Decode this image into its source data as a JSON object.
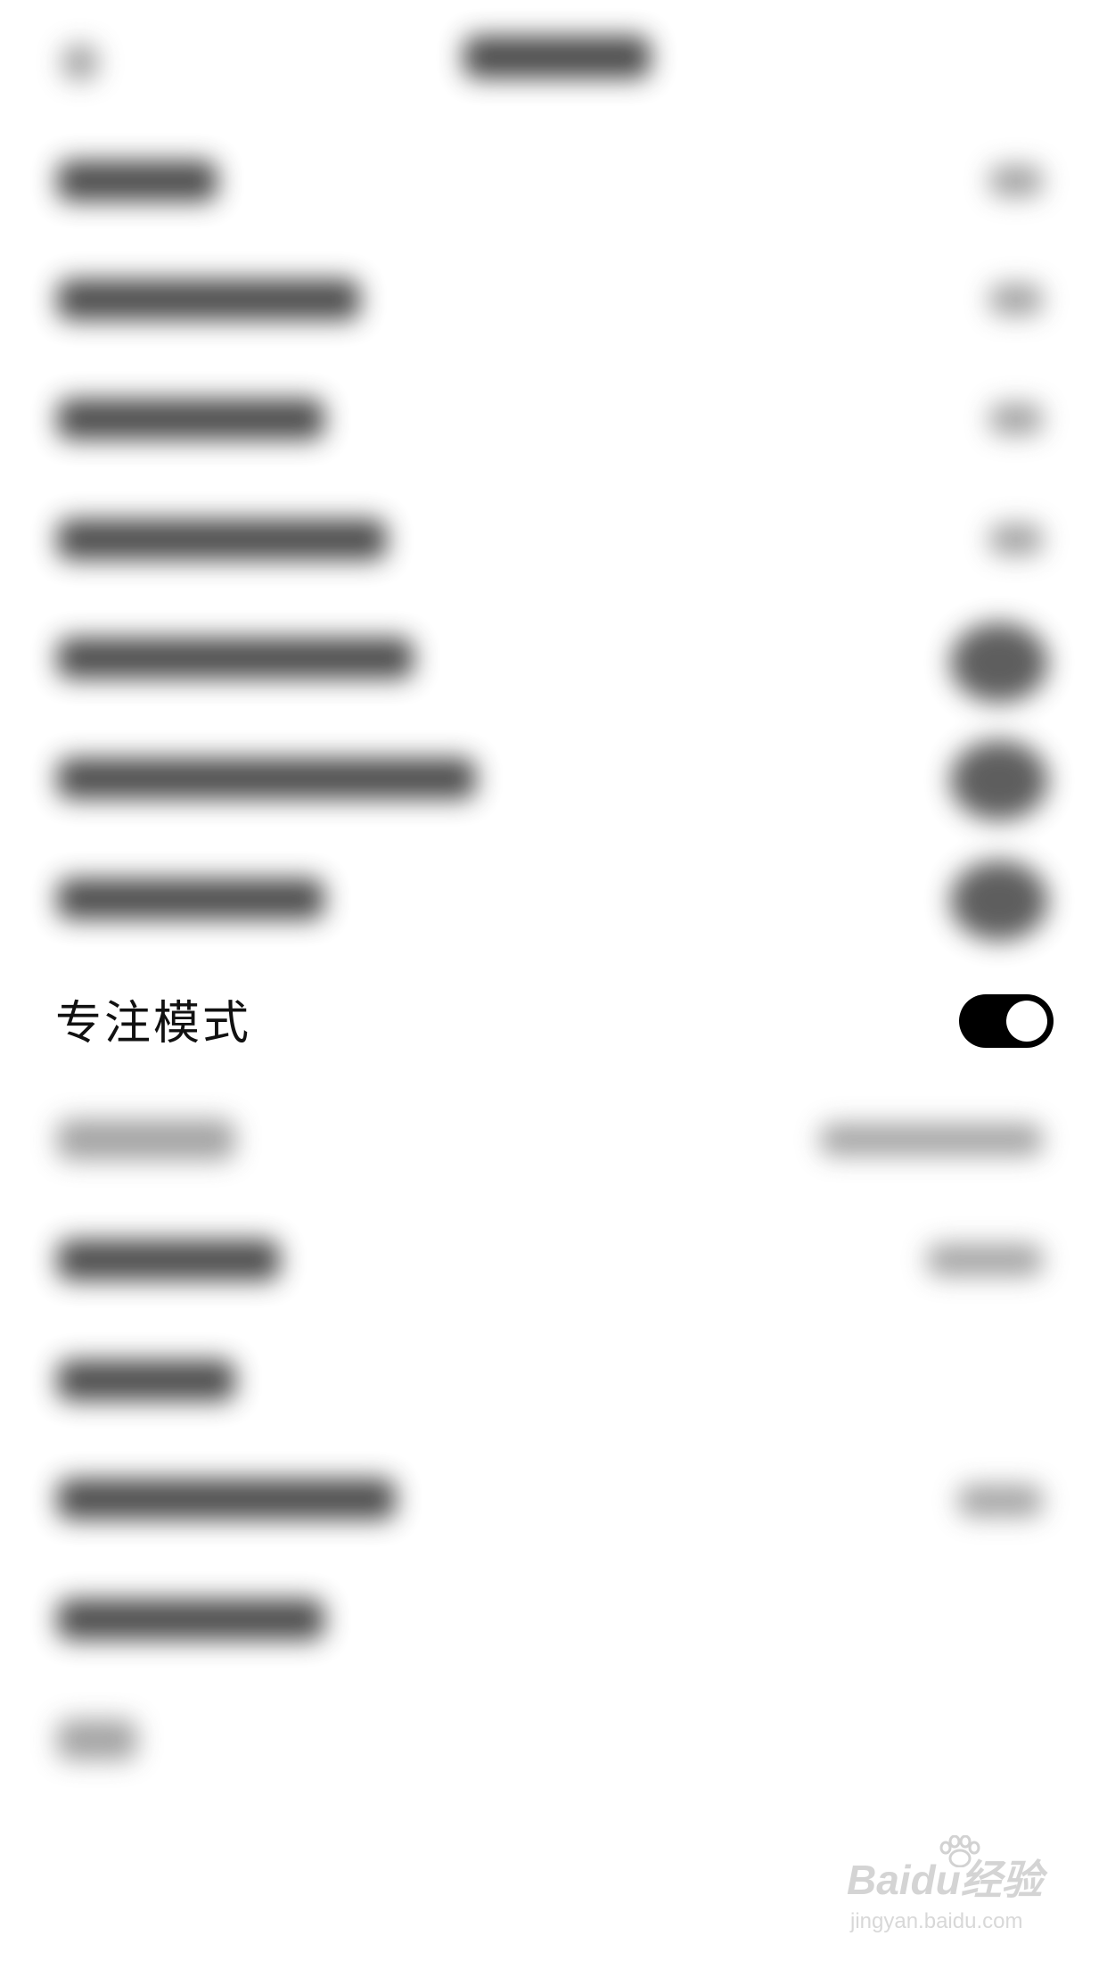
{
  "focus_setting": {
    "label": "专注模式",
    "enabled": true
  },
  "watermark": {
    "brand": "Baidu经验",
    "domain": "jingyan.baidu.com"
  },
  "colors": {
    "background": "#ffffff",
    "toggle_on": "#000000",
    "toggle_knob": "#ffffff",
    "text": "#111111"
  },
  "icons": {
    "toggle": "toggle-switch-on",
    "watermark_logo": "paw-icon"
  }
}
